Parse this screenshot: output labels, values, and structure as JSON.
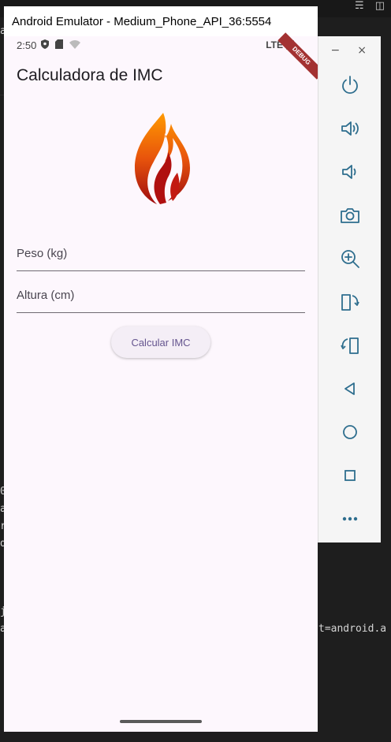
{
  "ide": {
    "bg_chars": [
      "a",
      "0",
      "a",
      "r",
      "d",
      "j",
      "a"
    ],
    "bg_code": "t=android.a"
  },
  "emulator": {
    "window_title": "Android Emulator - Medium_Phone_API_36:5554",
    "status": {
      "time": "2:50",
      "network": "LTE",
      "debug_label": "DEBUG"
    },
    "app": {
      "title": "Calculadora de IMC",
      "peso_placeholder": "Peso (kg)",
      "altura_placeholder": "Altura (cm)",
      "calculate_label": "Calcular IMC"
    }
  },
  "toolbar": {
    "minimize_label": "−",
    "close_label": "×",
    "buttons": [
      "power-icon",
      "volume-up-icon",
      "volume-down-icon",
      "camera-icon",
      "zoom-icon",
      "rotate-left-icon",
      "rotate-right-icon",
      "back-icon",
      "home-icon",
      "overview-icon",
      "more-icon"
    ]
  },
  "colors": {
    "app_background": "#fdf7fd",
    "button_text": "#65558f",
    "debug_ribbon": "#a33232"
  }
}
